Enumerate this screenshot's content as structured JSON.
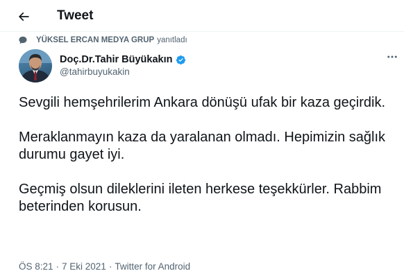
{
  "header": {
    "title": "Tweet"
  },
  "reply_context": {
    "account": "YÜKSEL ERCAN MEDYA GRUP",
    "suffix": "yanıtladı"
  },
  "author": {
    "name": "Doç.Dr.Tahir Büyükakın",
    "handle": "@tahirbuyukakin",
    "verified": true
  },
  "tweet": {
    "paragraphs": [
      "Sevgili hemşehrilerim Ankara dönüşü ufak bir kaza geçirdik.",
      "Meraklanmayın kaza da yaralanan olmadı. Hepimizin sağlık durumu gayet iyi.",
      "Geçmiş olsun dileklerini ileten herkese teşekkürler. Rabbim beterinden korusun."
    ]
  },
  "meta": {
    "time": "ÖS 8:21",
    "date": "7 Eki 2021",
    "separator": "·",
    "source": "Twitter for Android"
  },
  "colors": {
    "accent": "#1d9bf0",
    "text": "#0f1419",
    "secondary": "#536471"
  }
}
